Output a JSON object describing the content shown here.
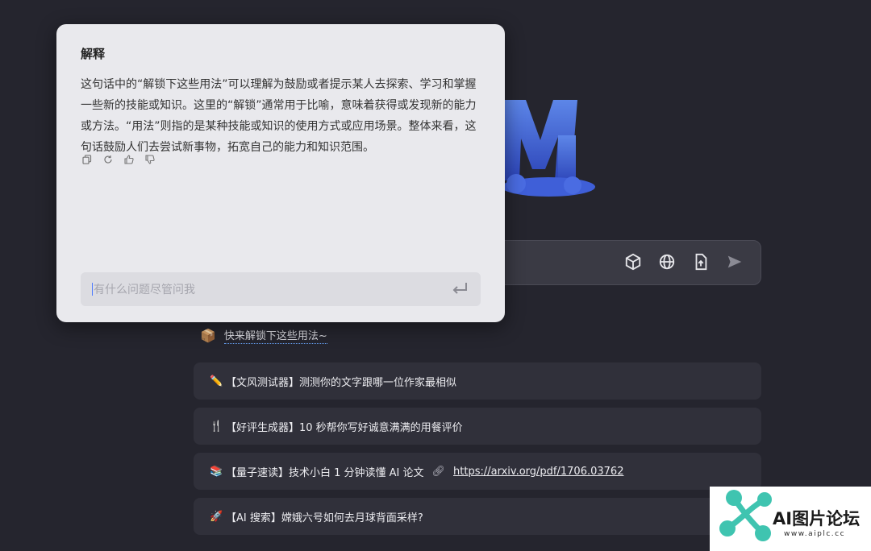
{
  "popup": {
    "title": "解释",
    "body": "这句话中的“解锁下这些用法”可以理解为鼓励或者提示某人去探索、学习和掌握一些新的技能或知识。这里的“解锁”通常用于比喻，意味着获得或发现新的能力或方法。“用法”则指的是某种技能或知识的使用方式或应用场景。整体来看，这句话鼓励人们去尝试新事物，拓宽自己的能力和知识范围。",
    "actions": [
      "copy-icon",
      "refresh-icon",
      "thumbs-up-icon",
      "thumbs-down-icon"
    ],
    "input_placeholder": "有什么问题尽管问我"
  },
  "main_input": {
    "tools": [
      "cube-icon",
      "globe-icon",
      "file-upload-icon",
      "send-icon"
    ]
  },
  "unlock": {
    "emoji": "📦",
    "text": "快来解锁下这些用法~"
  },
  "suggestions": [
    {
      "emoji": "✏️",
      "text": "【文风测试器】测测你的文字跟哪一位作家最相似"
    },
    {
      "emoji": "🍴",
      "text": "【好评生成器】10 秒帮你写好诚意满满的用餐评价"
    },
    {
      "emoji": "📚",
      "text": "【量子速读】技术小白 1 分钟读懂 AI 论文",
      "link": "https://arxiv.org/pdf/1706.03762"
    },
    {
      "emoji": "🚀",
      "text": "【AI 搜索】嫦娥六号如何去月球背面采样?"
    }
  ],
  "watermark": {
    "text": "AI图片论坛",
    "url": "www.aiplc.cc"
  },
  "colors": {
    "background": "#25252e",
    "card": "#30303a",
    "popup": "#e9e9ed",
    "accent": "#3fc4b0"
  }
}
